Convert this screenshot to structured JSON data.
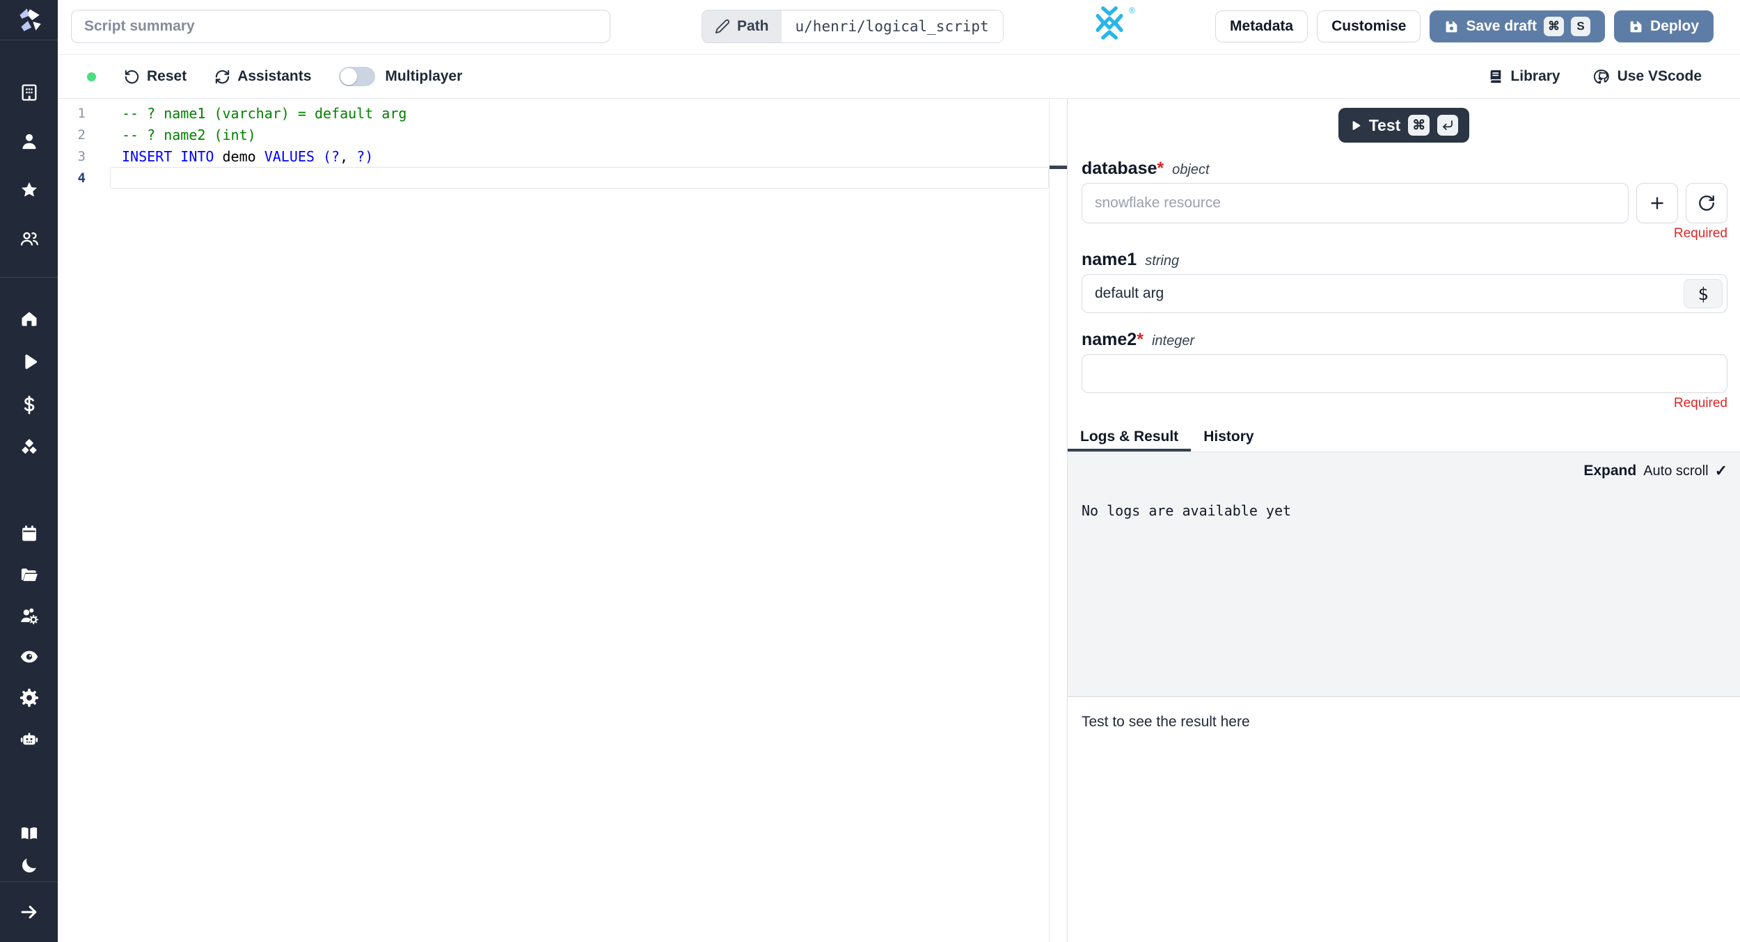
{
  "colors": {
    "sidebar_bg": "#222938",
    "accent_blue": "#5e7da6",
    "test_btn_bg": "#2b3544",
    "snowflake_blue": "#29b5e8",
    "status_green": "#4ade80",
    "required_red": "#dc2626",
    "code_comment": "#008000",
    "code_keyword": "#0000ff"
  },
  "sidebar": {
    "icons": [
      "windmill-logo",
      "building",
      "user",
      "star",
      "users",
      "home",
      "play",
      "dollar-sign",
      "boxes",
      "calendar",
      "folder-open",
      "users-cog",
      "eye",
      "settings-gear",
      "robot",
      "book-open",
      "moon",
      "arrow-right"
    ]
  },
  "topbar": {
    "summary_placeholder": "Script summary",
    "path_label": "Path",
    "path_value": "u/henri/logical_script",
    "snowflake_reg": "®",
    "metadata_label": "Metadata",
    "customise_label": "Customise",
    "save_draft_label": "Save draft",
    "save_kbd_meta": "⌘",
    "save_kbd_letter": "S",
    "deploy_label": "Deploy"
  },
  "toolbar": {
    "reset_label": "Reset",
    "assistants_label": "Assistants",
    "multiplayer_label": "Multiplayer",
    "multiplayer_on": false,
    "library_label": "Library",
    "vscode_label": "Use VScode"
  },
  "code": {
    "lines": [
      {
        "n": "1",
        "tokens": [
          {
            "t": "-- ? name1 (varchar) = default arg",
            "c": "comment"
          }
        ]
      },
      {
        "n": "2",
        "tokens": [
          {
            "t": "-- ? name2 (int)",
            "c": "comment"
          }
        ]
      },
      {
        "n": "3",
        "tokens": [
          {
            "t": "INSERT INTO",
            "c": "keyword"
          },
          {
            "t": " demo ",
            "c": "plain"
          },
          {
            "t": "VALUES",
            "c": "keyword"
          },
          {
            "t": " ",
            "c": "plain"
          },
          {
            "t": "(?",
            "c": "keyword"
          },
          {
            "t": ",",
            "c": "plain"
          },
          {
            "t": " ?)",
            "c": "keyword"
          }
        ]
      },
      {
        "n": "4",
        "tokens": [],
        "active": true
      }
    ]
  },
  "run_panel": {
    "test_label": "Test",
    "test_kbd_meta": "⌘",
    "fields": {
      "database": {
        "label": "database",
        "star": "*",
        "type": "object",
        "placeholder": "snowflake resource",
        "required_msg": "Required"
      },
      "name1": {
        "label": "name1",
        "type": "string",
        "value": "default arg",
        "dollar": "$"
      },
      "name2": {
        "label": "name2",
        "star": "*",
        "type": "integer",
        "required_msg": "Required"
      }
    },
    "tabs": {
      "logs": "Logs & Result",
      "history": "History"
    },
    "logs": {
      "expand": "Expand",
      "autoscroll": "Auto scroll",
      "check": "✓",
      "empty": "No logs are available yet"
    },
    "result_placeholder": "Test to see the result here"
  }
}
